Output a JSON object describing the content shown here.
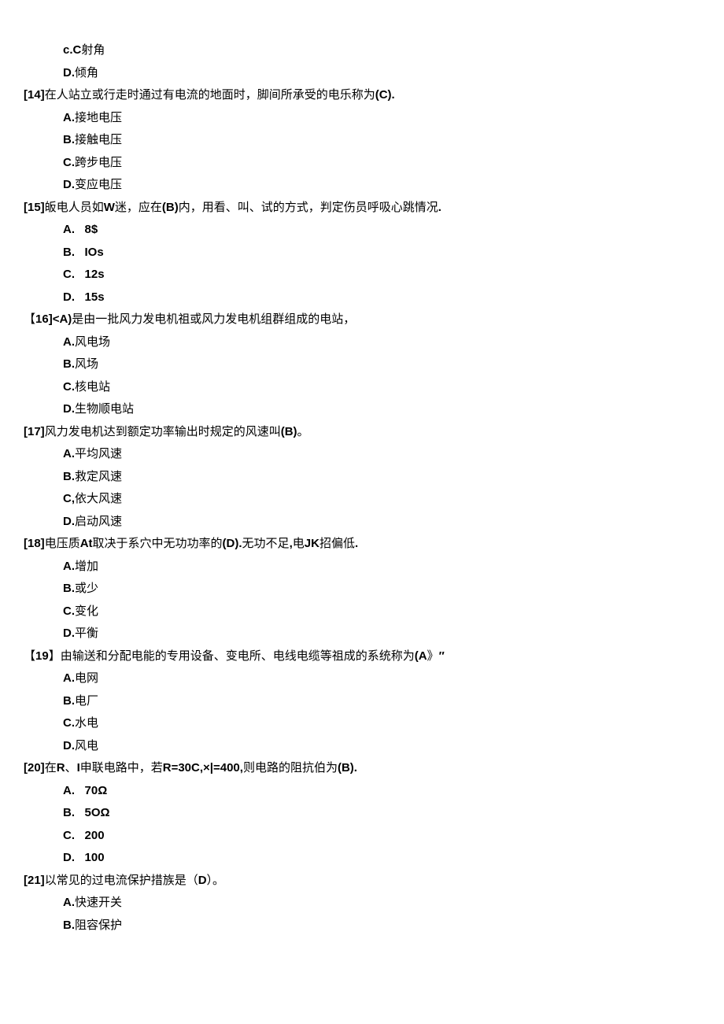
{
  "lines": [
    {
      "cls": "opt",
      "text": "c.C射角"
    },
    {
      "cls": "opt",
      "text": "D.倾角"
    },
    {
      "cls": "stem",
      "text": "[14]在人站立或行走时通过有电流的地面时，脚间所承受的电乐称为(C)."
    },
    {
      "cls": "opt",
      "text": "A.接地电压"
    },
    {
      "cls": "opt",
      "text": "B.接触电压"
    },
    {
      "cls": "opt",
      "text": "C.跨步电压"
    },
    {
      "cls": "opt",
      "text": "D.变应电压"
    },
    {
      "cls": "stem",
      "text": "[15]皈电人员如W迷，应在(B)内，用看、叫、试的方式，判定伤员呼吸心跳情况."
    },
    {
      "cls": "opt",
      "text": "A.   8$"
    },
    {
      "cls": "opt",
      "text": "B.   IOs"
    },
    {
      "cls": "opt",
      "text": "C.   12s"
    },
    {
      "cls": "opt",
      "text": "D.   15s"
    },
    {
      "cls": "stem",
      "text": "【16]<A)是由一批风力发电机祖或风力发电机组群组成的电站，"
    },
    {
      "cls": "opt",
      "text": "A.风电场"
    },
    {
      "cls": "opt",
      "text": "B.风场"
    },
    {
      "cls": "opt",
      "text": "C.核电站"
    },
    {
      "cls": "opt",
      "text": "D.生物顺电站"
    },
    {
      "cls": "stem",
      "text": "[17]风力发电机达到额定功率输出时规定的风速叫(B)。"
    },
    {
      "cls": "opt",
      "text": "A.平均风速"
    },
    {
      "cls": "opt",
      "text": "B.救定风速"
    },
    {
      "cls": "opt",
      "text": "C,依大风速"
    },
    {
      "cls": "opt",
      "text": "D.启动风速"
    },
    {
      "cls": "stem",
      "text": "[18]电压质At取决于系穴中无功功率的(D).无功不足,电JK招偏低."
    },
    {
      "cls": "opt",
      "text": "A.增加"
    },
    {
      "cls": "opt",
      "text": "B.或少"
    },
    {
      "cls": "opt",
      "text": "C.变化"
    },
    {
      "cls": "opt",
      "text": "D.平衡"
    },
    {
      "cls": "stem",
      "text": "【19】由输送和分配电能的专用设备、变电所、电线电缆等祖成的系统称为(A》″"
    },
    {
      "cls": "opt",
      "text": "A.电网"
    },
    {
      "cls": "opt",
      "text": "B.电厂"
    },
    {
      "cls": "opt",
      "text": "C.水电"
    },
    {
      "cls": "opt",
      "text": "D.风电"
    },
    {
      "cls": "stem",
      "text": "[20]在R、I申联电路中，若R=30C,×|=400,则电路的阻抗伯为(B)."
    },
    {
      "cls": "opt",
      "text": "A.   70Ω"
    },
    {
      "cls": "opt",
      "text": "B.   5OΩ"
    },
    {
      "cls": "opt",
      "text": "C.   200"
    },
    {
      "cls": "opt",
      "text": "D.   100"
    },
    {
      "cls": "stem",
      "text": "[21]以常见的过电流保护措族是（D）。"
    },
    {
      "cls": "opt",
      "text": "A.快速开关"
    },
    {
      "cls": "opt",
      "text": "B.阻容保护"
    }
  ]
}
